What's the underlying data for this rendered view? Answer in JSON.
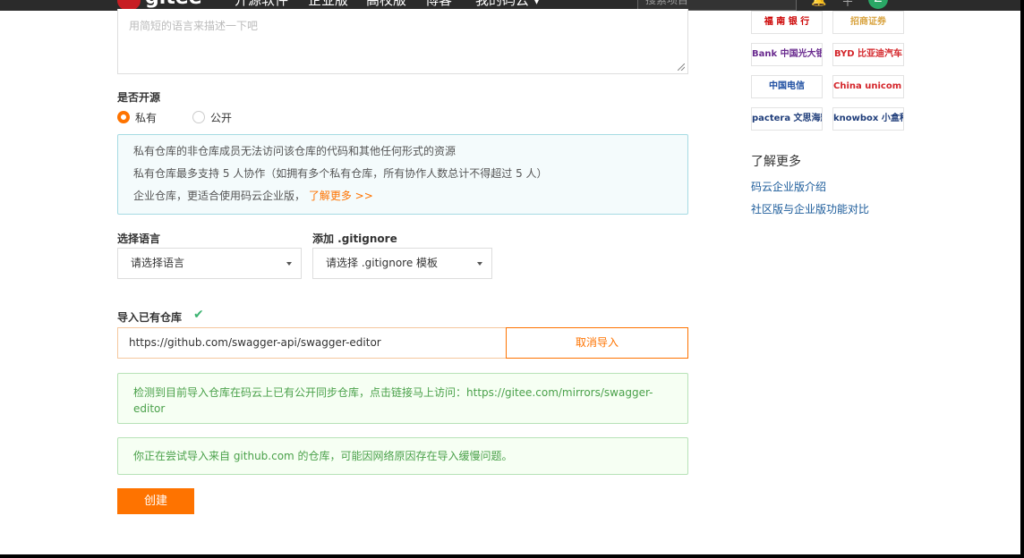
{
  "topnav": {
    "logo": "gitee",
    "items": [
      "开源软件",
      "企业版",
      "高校版",
      "博客",
      "我的码云 ▾"
    ],
    "search_placeholder": "搜索项目",
    "avatar_letter": "Z"
  },
  "form": {
    "description_placeholder": "用简短的语言来描述一下吧",
    "open_source_label": "是否开源",
    "radio_private": "私有",
    "radio_public": "公开",
    "info_lines": [
      "私有仓库的非仓库成员无法访问该仓库的代码和其他任何形式的资源",
      "私有仓库最多支持 5 人协作（如拥有多个私有仓库，所有协作人数总计不得超过 5 人）",
      "企业仓库，更适合使用码云企业版，"
    ],
    "learn_more": "了解更多 >>",
    "language_label": "选择语言",
    "language_value": "请选择语言",
    "gitignore_label": "添加 .gitignore",
    "gitignore_value": "请选择 .gitignore 模板",
    "import_label": "导入已有仓库",
    "import_url": "https://github.com/swagger-api/swagger-editor",
    "cancel_import": "取消导入",
    "mirror_notice": "检测到目前导入仓库在码云上已有公开同步仓库，点击链接马上访问：https://gitee.com/mirrors/swagger-editor",
    "slow_notice": "你正在尝试导入来自 github.com 的仓库，可能因网络原因存在导入缓慢问题。",
    "create_button": "创建"
  },
  "sidebar": {
    "logos": [
      "福 南 银 行",
      "招商证券",
      "Bank 中国光大银行",
      "BYD 比亚迪汽车",
      "中国电信",
      "China unicom 中国联通",
      "pactera 文思海辉",
      "knowbox 小盒科技"
    ],
    "learn_more_title": "了解更多",
    "links": [
      "码云企业版介绍",
      "社区版与企业版功能对比"
    ]
  },
  "colors": {
    "accent": "#fe7300",
    "info_border": "#a6dbe3",
    "success_text": "#4aa14a",
    "link": "#1b5b9a"
  }
}
